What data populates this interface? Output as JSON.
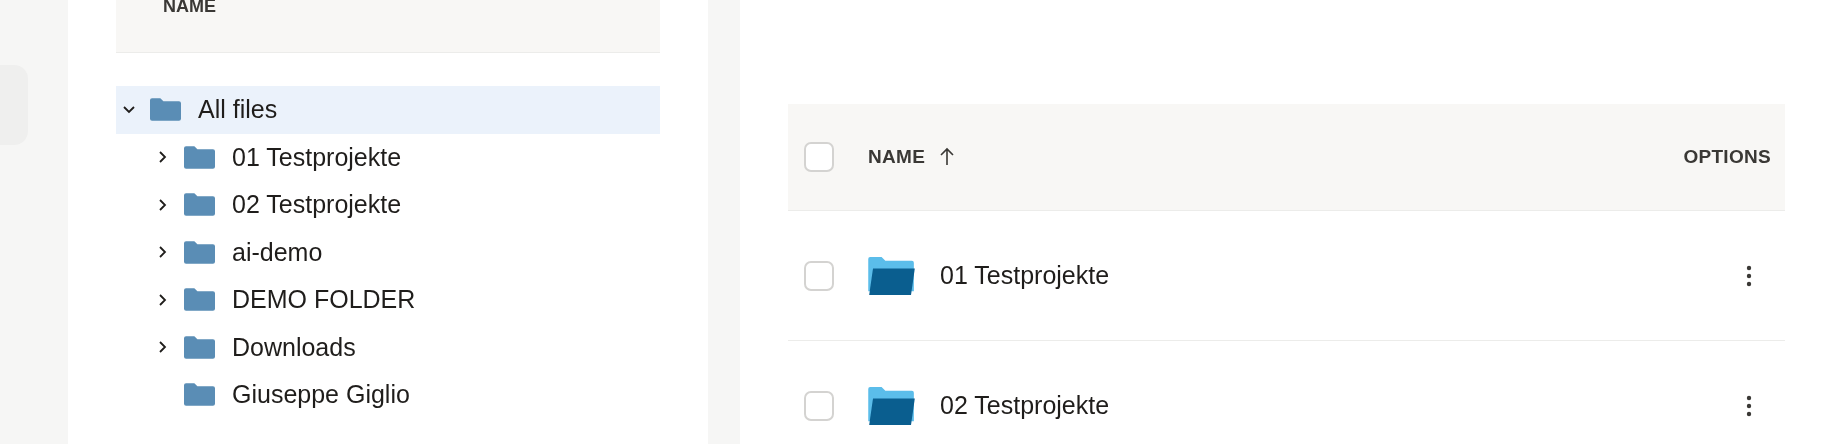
{
  "tree_panel": {
    "header": "NAME",
    "tree": {
      "label": "All files",
      "expandable": true,
      "expanded": true,
      "selected": true,
      "children": [
        {
          "label": "01 Testprojekte",
          "expandable": true,
          "expanded": false,
          "selected": false
        },
        {
          "label": "02 Testprojekte",
          "expandable": true,
          "expanded": false,
          "selected": false
        },
        {
          "label": "ai-demo",
          "expandable": true,
          "expanded": false,
          "selected": false
        },
        {
          "label": "DEMO FOLDER",
          "expandable": true,
          "expanded": false,
          "selected": false
        },
        {
          "label": "Downloads",
          "expandable": true,
          "expanded": false,
          "selected": false
        },
        {
          "label": "Giuseppe Giglio",
          "expandable": false,
          "expanded": false,
          "selected": false
        }
      ]
    }
  },
  "table": {
    "select_all_checked": false,
    "columns": [
      {
        "label": "NAME",
        "sorted": true
      },
      {
        "label": "OPTIONS",
        "sorted": false
      }
    ],
    "rows": [
      {
        "name": "01 Testprojekte",
        "checked": false
      },
      {
        "name": "02 Testprojekte",
        "checked": false
      }
    ]
  }
}
